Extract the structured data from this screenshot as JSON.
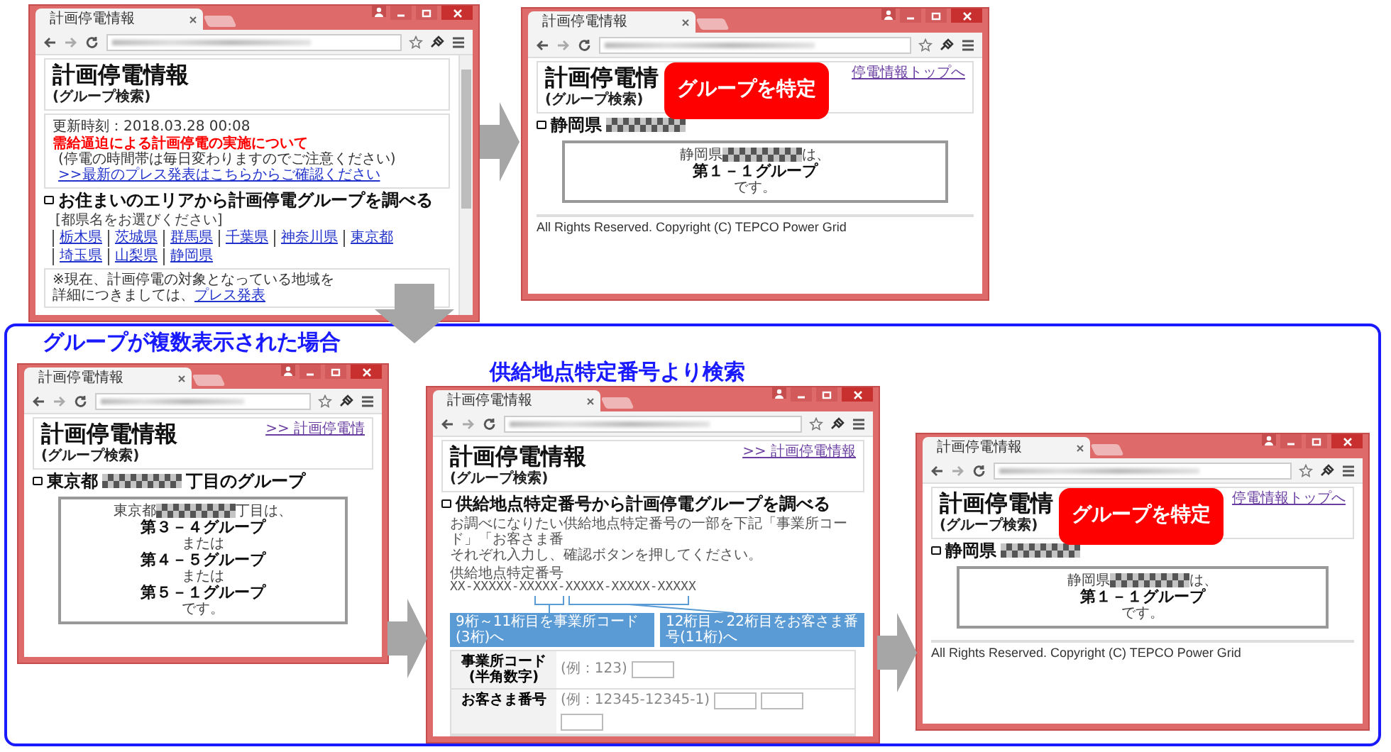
{
  "captions": [
    {
      "text": "グループが複数表示された場合"
    },
    {
      "text": "供給地点特定番号より検索"
    }
  ],
  "windows": [
    {
      "tab": "計画停電情報",
      "scrollbar": true,
      "blocks": [
        {
          "kind": "header",
          "title": "計画停電情報",
          "subtitle": "(グループ検索)"
        },
        {
          "kind": "info",
          "updated": "更新時刻：2018.03.28 00:08",
          "alert": "需給逼迫による計画停電の実施について",
          "note": "(停電の時間帯は毎日変わりますのでご注意ください)",
          "link": ">>最新のプレス発表はこちらからご確認ください"
        },
        {
          "kind": "heading",
          "text": "お住まいのエリアから計画停電グループを調べる"
        },
        {
          "kind": "prefectures",
          "prompt": "[都県名をお選びください]",
          "links": [
            "栃木県",
            "茨城県",
            "群馬県",
            "千葉県",
            "神奈川県",
            "東京都",
            "埼玉県",
            "山梨県",
            "静岡県"
          ]
        },
        {
          "kind": "footnote",
          "line1": "※現在、計画停電の対象となっている地域を",
          "line2": "詳細につきましては、",
          "link": "プレス発表"
        }
      ]
    },
    {
      "tab": "計画停電情報",
      "callout": "グループを特定",
      "blocks": [
        {
          "kind": "header",
          "title": "計画停電情",
          "subtitle": "(グループ検索)",
          "link": "停電情報トップへ"
        },
        {
          "kind": "heading",
          "text": "静岡県",
          "masked": true
        },
        {
          "kind": "result",
          "lines": [
            {
              "text": "静岡県",
              "masked": true,
              "suffix": "は、",
              "bold": false
            },
            {
              "text": "第１－１グループ",
              "masked": false,
              "bold": true
            },
            {
              "text": "です。",
              "masked": false,
              "bold": false
            }
          ]
        },
        {
          "kind": "footer",
          "text": "All Rights Reserved. Copyright (C) TEPCO Power Grid"
        }
      ]
    },
    {
      "tab": "計画停電情報",
      "blocks": [
        {
          "kind": "header",
          "title": "計画停電情報",
          "subtitle": "(グループ検索)",
          "link": ">> 計画停電情"
        },
        {
          "kind": "heading",
          "text": "東京都",
          "masked": true,
          "suffix": "丁目のグループ"
        },
        {
          "kind": "result",
          "lines": [
            {
              "text": "東京都",
              "masked": true,
              "suffix": "丁目は、",
              "bold": false
            },
            {
              "text": "第３－４グループ",
              "masked": false,
              "bold": true
            },
            {
              "text": "または",
              "masked": false,
              "bold": false
            },
            {
              "text": "第４－５グループ",
              "masked": false,
              "bold": true
            },
            {
              "text": "または",
              "masked": false,
              "bold": false
            },
            {
              "text": "第５－１グループ",
              "masked": false,
              "bold": true
            },
            {
              "text": "です。",
              "masked": false,
              "bold": false
            }
          ]
        }
      ]
    },
    {
      "tab": "計画停電情報",
      "blocks": [
        {
          "kind": "header",
          "title": "計画停電情報",
          "subtitle": "(グループ検索)",
          "link": ">> 計画停電情報"
        },
        {
          "kind": "heading",
          "text": "供給地点特定番号から計画停電グループを調べる"
        },
        {
          "kind": "paragraph",
          "lines": [
            "お調べになりたい供給地点特定番号の一部を下記「事業所コード」「お客さま番",
            "それぞれ入力し、確認ボタンを押してください。"
          ]
        },
        {
          "kind": "number_diagram",
          "label": "供給地点特定番号",
          "format": "XX-XXXXX-XXXXX-XXXXX-XXXXX-XXXXX",
          "hints": [
            "9桁～11桁目を事業所コード(3桁)へ",
            "12桁目～22桁目をお客さま番号(11桁)へ"
          ]
        },
        {
          "kind": "form",
          "rows": [
            {
              "kind": "single",
              "label": "事業所コード",
              "sublabel": "(半角数字)",
              "example": "(例：123)"
            },
            {
              "kind": "triple",
              "label": "お客さま番号",
              "example": "(例：12345-12345-1)"
            }
          ]
        }
      ]
    },
    {
      "tab": "計画停電情報",
      "callout": "グループを特定",
      "blocks": [
        {
          "kind": "header",
          "title": "計画停電情",
          "subtitle": "(グループ検索)",
          "link": "停電情報トップへ"
        },
        {
          "kind": "heading",
          "text": "静岡県",
          "masked": true
        },
        {
          "kind": "result",
          "lines": [
            {
              "text": "静岡県",
              "masked": true,
              "suffix": "は、",
              "bold": false
            },
            {
              "text": "第１－１グループ",
              "masked": false,
              "bold": true
            },
            {
              "text": "です。",
              "masked": false,
              "bold": false
            }
          ]
        },
        {
          "kind": "footer",
          "text": "All Rights Reserved. Copyright (C) TEPCO Power Grid"
        }
      ]
    }
  ]
}
